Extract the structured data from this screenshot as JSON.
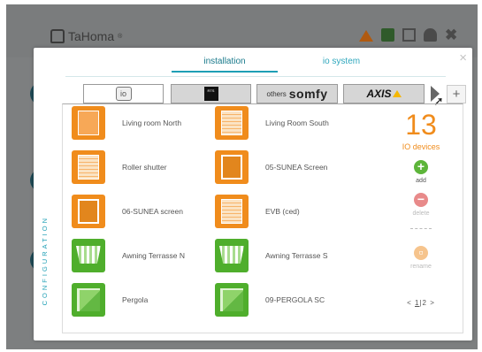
{
  "app": {
    "title": "TaHoma",
    "trademark": "®"
  },
  "header_icons": [
    "warning-icon",
    "home-icon",
    "mail-icon",
    "user-icon",
    "tools-icon"
  ],
  "modal": {
    "close_glyph": "×",
    "tabs": [
      {
        "label": "installation",
        "active": true
      },
      {
        "label": "io system",
        "active": false
      }
    ],
    "protocols": [
      {
        "name": "io",
        "label": "io",
        "active": true
      },
      {
        "name": "rts",
        "label": "RTS",
        "active": false
      },
      {
        "name": "somfy",
        "others": "others",
        "brand": "somfy",
        "active": false
      },
      {
        "name": "axis",
        "label": "AXIS",
        "active": false
      }
    ],
    "add_tab_glyph": "+",
    "devices": [
      {
        "label": "Living room North",
        "icon": "window-icon",
        "color": "orange"
      },
      {
        "label": "Living Room South",
        "icon": "shutter-icon",
        "color": "orange"
      },
      {
        "label": "Roller shutter",
        "icon": "shutter-icon",
        "color": "orange"
      },
      {
        "label": "05-SUNEA Screen",
        "icon": "screen-icon",
        "color": "orange"
      },
      {
        "label": "06-SUNEA screen",
        "icon": "screen-icon",
        "color": "orange"
      },
      {
        "label": "EVB (ced)",
        "icon": "venetian-blind-icon",
        "color": "orange"
      },
      {
        "label": "Awning Terrasse N",
        "icon": "awning-icon",
        "color": "green"
      },
      {
        "label": "Awning Terrasse S",
        "icon": "awning-icon",
        "color": "green"
      },
      {
        "label": "Pergola",
        "icon": "pergola-icon",
        "color": "green"
      },
      {
        "label": "09-PERGOLA SC",
        "icon": "pergola-icon",
        "color": "green"
      }
    ],
    "device_count": "13",
    "device_count_label": "IO devices",
    "actions": {
      "add": "add",
      "delete": "delete",
      "rename": "rename"
    },
    "pagination": {
      "prev": "<",
      "page1": "1",
      "sep": "|",
      "page2": "2",
      "next": ">"
    },
    "side_label": "CONFIGURATION"
  },
  "colors": {
    "accent": "#1e9fb5",
    "orange": "#f08c1c",
    "green": "#4fae2c"
  }
}
